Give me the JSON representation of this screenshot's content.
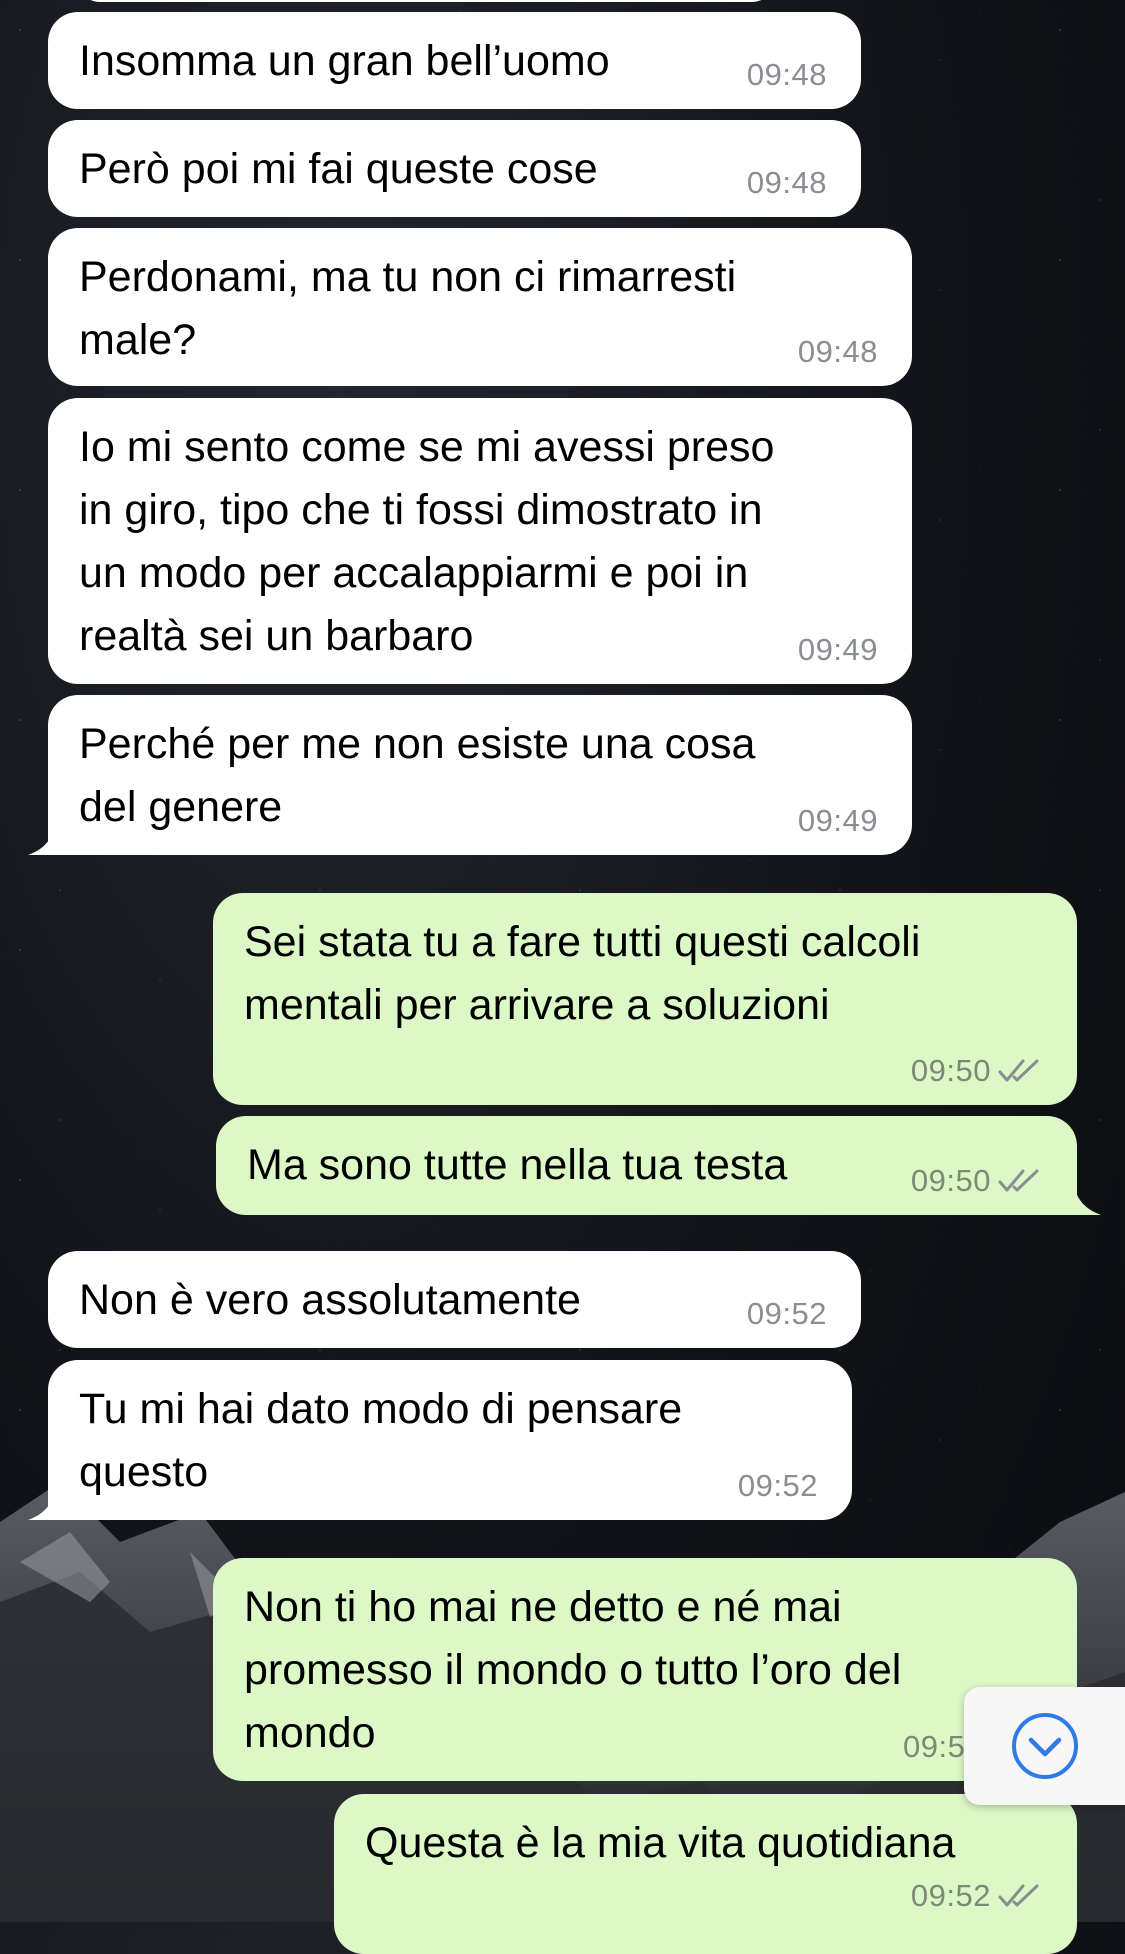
{
  "theme": {
    "incoming_bubble": "#ffffff",
    "outgoing_bubble": "#dcf8c6",
    "timestamp": "#8a8d91",
    "read_ticks": "#8a8d91",
    "scroll_button_accent": "#2f7ae5"
  },
  "messages": [
    {
      "direction": "in",
      "text": "Insomma un gran bell’uomo",
      "time": "09:48"
    },
    {
      "direction": "in",
      "text": "Però poi mi fai queste cose",
      "time": "09:48"
    },
    {
      "direction": "in",
      "text": "Perdonami, ma tu non ci rimarresti\nmale?",
      "time": "09:48"
    },
    {
      "direction": "in",
      "text": "Io mi sento come se mi avessi preso\nin giro, tipo che ti fossi dimostrato in\nun modo per accalappiarmi e poi in\nrealtà sei un barbaro",
      "time": "09:49"
    },
    {
      "direction": "in",
      "text": "Perché per me non esiste una cosa\ndel genere",
      "time": "09:49"
    },
    {
      "direction": "out",
      "text": "Sei stata tu a fare tutti questi calcoli\nmentali per arrivare a soluzioni",
      "time": "09:50",
      "status": "read"
    },
    {
      "direction": "out",
      "text": "Ma sono tutte nella tua testa",
      "time": "09:50",
      "status": "read"
    },
    {
      "direction": "in",
      "text": "Non è vero assolutamente",
      "time": "09:52"
    },
    {
      "direction": "in",
      "text": "Tu mi hai dato modo di pensare\nquesto",
      "time": "09:52"
    },
    {
      "direction": "out",
      "text": "Non ti ho mai ne detto e né mai\npromesso il mondo o tutto l’oro del\nmondo",
      "time": "09:5",
      "status": "read"
    },
    {
      "direction": "out",
      "text": "Questa è la mia vita quotidiana",
      "time": "09:52",
      "status": "read"
    }
  ],
  "scroll_to_bottom": {
    "icon": "chevron-down-circle-icon"
  }
}
